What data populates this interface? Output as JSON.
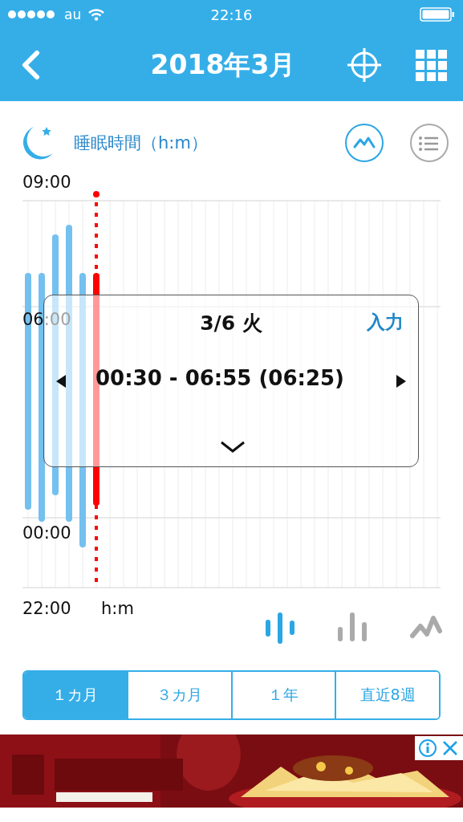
{
  "status_bar": {
    "carrier": "au",
    "time": "22:16"
  },
  "nav": {
    "title": "2018年3月"
  },
  "metric": {
    "title": "睡眠時間（h:m）",
    "views": [
      {
        "kind": "line",
        "selected": true
      },
      {
        "kind": "list",
        "selected": false
      }
    ]
  },
  "chart": {
    "y_labels": [
      "09:00",
      "06:00",
      "00:00",
      "22:00"
    ],
    "unit": "h:m",
    "bars": [
      {
        "selected": false
      },
      {
        "selected": false
      },
      {
        "selected": false
      },
      {
        "selected": false
      },
      {
        "selected": false
      },
      {
        "selected": true
      }
    ]
  },
  "detail_popup": {
    "date": "3/6 火",
    "input_link": "入力",
    "range": "00:30 - 06:55 (06:25)"
  },
  "chart_types": [
    {
      "kind": "range",
      "selected": true
    },
    {
      "kind": "bar",
      "selected": false
    },
    {
      "kind": "line",
      "selected": false
    }
  ],
  "periods": [
    {
      "label": "１カ月",
      "selected": true
    },
    {
      "label": "３カ月",
      "selected": false
    },
    {
      "label": "１年",
      "selected": false
    },
    {
      "label": "直近8週",
      "selected": false
    }
  ]
}
